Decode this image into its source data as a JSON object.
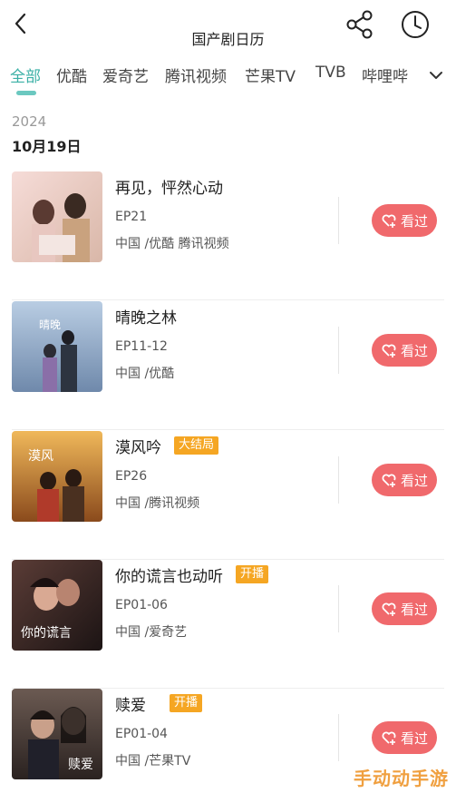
{
  "header": {
    "title": "国产剧日历",
    "icons": {
      "back": "chevron-left-icon",
      "share": "share-icon",
      "history": "clock-icon"
    }
  },
  "tabs": [
    {
      "label": "全部",
      "active": true
    },
    {
      "label": "优酷"
    },
    {
      "label": "爱奇艺"
    },
    {
      "label": "腾讯视频"
    },
    {
      "label": "芒果TV"
    },
    {
      "label": "TVB"
    },
    {
      "label": "哔哩哔"
    }
  ],
  "date": {
    "year": "2024",
    "day": "10月19日"
  },
  "items": [
    {
      "title": "再见，怦然心动",
      "badge": "",
      "episode": "EP21",
      "platforms": "中国 /优酷 腾讯视频",
      "button": "看过"
    },
    {
      "title": "晴晚之林",
      "badge": "",
      "episode": "EP11-12",
      "platforms": "中国 /优酷",
      "button": "看过"
    },
    {
      "title": "漠风吟",
      "badge": "大结局",
      "episode": "EP26",
      "platforms": "中国 /腾讯视频",
      "button": "看过"
    },
    {
      "title": "你的谎言也动听",
      "badge": "开播",
      "episode": "EP01-06",
      "platforms": "中国 /爱奇艺",
      "button": "看过"
    },
    {
      "title": "赎爱",
      "badge": "开播",
      "episode": "EP01-04",
      "platforms": "中国 /芒果TV",
      "button": "看过"
    }
  ],
  "watermark": "手动动手游",
  "colors": {
    "accent": "#3bb0a6",
    "button": "#f0696c",
    "badge": "#f5a623"
  }
}
